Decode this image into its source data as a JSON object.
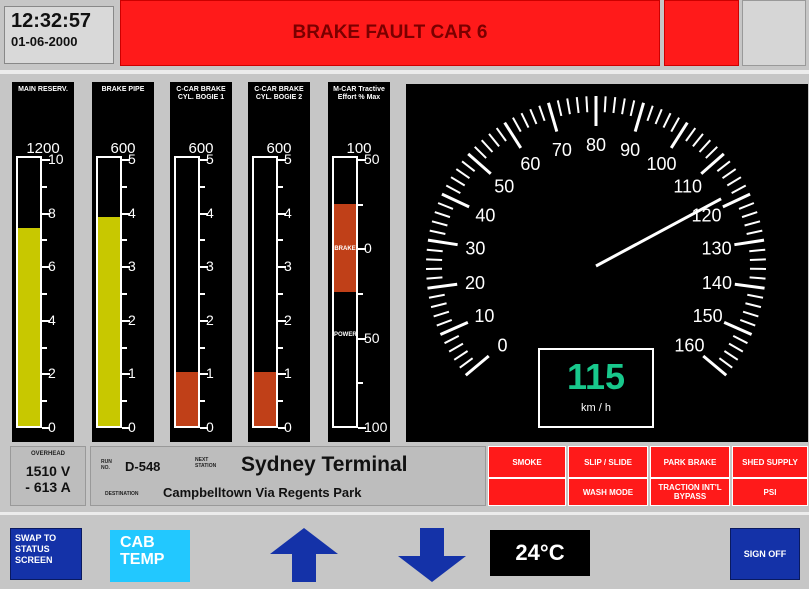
{
  "header": {
    "time": "12:32:57",
    "date": "01-06-2000",
    "alarm": "BRAKE FAULT CAR 6"
  },
  "gauges": [
    {
      "title": "MAIN RESERV.",
      "max": "1200",
      "labels": [
        "10",
        "8",
        "6",
        "4",
        "2",
        "0"
      ],
      "fill_fraction": 0.74,
      "color": "#c8c800"
    },
    {
      "title": "BRAKE PIPE",
      "max": "600",
      "labels": [
        "5",
        "4",
        "3",
        "2",
        "1",
        "0"
      ],
      "fill_fraction": 0.78,
      "color": "#c8c800"
    },
    {
      "title": "C-CAR BRAKE CYL. BOGIE 1",
      "max": "600",
      "labels": [
        "5",
        "4",
        "3",
        "2",
        "1",
        "0"
      ],
      "fill_fraction": 0.2,
      "color": "#c04018"
    },
    {
      "title": "C-CAR BRAKE CYL. BOGIE 2",
      "max": "600",
      "labels": [
        "5",
        "4",
        "3",
        "2",
        "1",
        "0"
      ],
      "fill_fraction": 0.2,
      "color": "#c04018"
    },
    {
      "title": "M-CAR Tractive Effort % Max",
      "max": "100",
      "labels": [
        "50",
        "0",
        "50",
        "100"
      ],
      "brake_label": "BRAKE",
      "power_label": "POWER",
      "color": "#c04018"
    }
  ],
  "speedometer": {
    "labels": [
      "0",
      "10",
      "20",
      "30",
      "40",
      "50",
      "60",
      "70",
      "80",
      "90",
      "100",
      "110",
      "120",
      "130",
      "140",
      "150",
      "160"
    ],
    "speed": "115",
    "unit": "km / h",
    "needle_value": 118,
    "max": 160
  },
  "overhead": {
    "label": "OVERHEAD",
    "voltage": "1510 V",
    "current": "- 613 A"
  },
  "run": {
    "run_label": "RUN NO.",
    "run_no": "D-548",
    "next_label": "NEXT STATION",
    "next_station": "Sydney Terminal",
    "dest_label": "DESTINATION",
    "destination": "Campbelltown Via Regents Park"
  },
  "alarm_buttons": {
    "smoke": "SMOKE",
    "slip": "SLIP / SLIDE",
    "park": "PARK BRAKE",
    "shed": "SHED SUPPLY",
    "wash": "WASH MODE",
    "traction": "TRACTION INT'L BYPASS",
    "psi": "PSI"
  },
  "footer": {
    "swap": "SWAP TO STATUS SCREEN",
    "cab_temp": "CAB TEMP",
    "temperature": "24°C",
    "sign_off": "SIGN OFF"
  }
}
